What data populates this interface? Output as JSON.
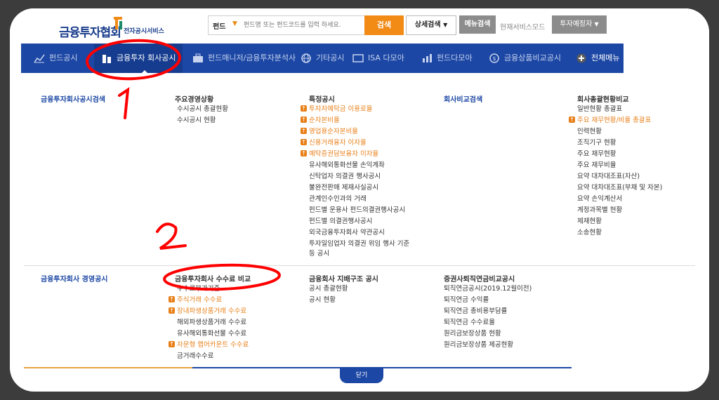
{
  "header": {
    "logo_main": "금융투자협회",
    "logo_sub": "전자공시서비스",
    "search_category": "펀드",
    "search_placeholder": "펀드명 또는 펀드코드를 입력 하세요.",
    "search_button": "검색",
    "detail_search_button": "상세검색",
    "menu_search_button": "메뉴검색",
    "service_mode_label": "현재서비스모드",
    "mode_select": "투자예정자"
  },
  "nav": {
    "items": [
      {
        "label": "펀드공시",
        "icon": "chart-icon"
      },
      {
        "label": "금융투자 회사공시",
        "icon": "building-icon"
      },
      {
        "label": "펀드매니저/금융투자분석사",
        "icon": "briefcase-icon"
      },
      {
        "label": "기타공시",
        "icon": "globe-icon"
      },
      {
        "label": "ISA 다모아",
        "icon": "isa-icon"
      },
      {
        "label": "펀드다모아",
        "icon": "bars-icon"
      },
      {
        "label": "금융상품비교공시",
        "icon": "coin-icon"
      },
      {
        "label": "전체메뉴",
        "icon": "plus-circle-icon"
      }
    ]
  },
  "menu": {
    "col1_top": "금융투자회사공시검색",
    "col2_top": "주요경영상황",
    "col2_top_items": [
      "수시공시 총괄현황",
      "수시공시 현황"
    ],
    "col3_top": "특정공시",
    "col3_top_items_orange": [
      "투자자예탁금 이용료율",
      "순자본비율",
      "영업용순자본비율",
      "신용거래융자 이자율",
      "예탁증권담보융자 이자율"
    ],
    "col3_top_items": [
      "유사해외통화선물 손익계좌",
      "신탁업자 의결권 행사공시",
      "불완전판매 제재사실공시",
      "관계인수인과의 거래",
      "펀드별 운용사 펀드의결권행사공시",
      "펀드별 의결권행사공시",
      "외국금융투자회사 약관공시",
      "투자일임업자 의결권 위임 행사 기준",
      "등 공시"
    ],
    "col4_top": "회사비교검색",
    "col5_top": "회사총괄현황비교",
    "col5_items": [
      {
        "label": "일반현황 총괄표",
        "orange": false
      },
      {
        "label": "주요 재무현황/비율 총괄표",
        "orange": true
      },
      {
        "label": "인력현황",
        "orange": false
      },
      {
        "label": "조직기구 현황",
        "orange": false
      },
      {
        "label": "주요 재무현황",
        "orange": false
      },
      {
        "label": "주요 재무비율",
        "orange": false
      },
      {
        "label": "요약 대차대조표(자산)",
        "orange": false
      },
      {
        "label": "요약 대차대조표(부채 및 자본)",
        "orange": false
      },
      {
        "label": "요약 손익계산서",
        "orange": false
      },
      {
        "label": "계정과목별 현황",
        "orange": false
      },
      {
        "label": "제재현황",
        "orange": false
      },
      {
        "label": "소송현황",
        "orange": false
      }
    ],
    "col1_bottom": "금융투자회사 경영공시",
    "col2_bottom": "금융투자회사 수수료 비교",
    "col2_bottom_items": [
      {
        "label": "수수료부과기준",
        "orange": false
      },
      {
        "label": "주식거래 수수료",
        "orange": true
      },
      {
        "label": "장내파생상품거래 수수료",
        "orange": true
      },
      {
        "label": "해외파생상품거래 수수료",
        "orange": false
      },
      {
        "label": "유사해외통화선물 수수료",
        "orange": false
      },
      {
        "label": "자문형 랩어카운트 수수료",
        "orange": true
      },
      {
        "label": "금거래수수료",
        "orange": false
      }
    ],
    "col3_bottom": "금융회사 지배구조 공시",
    "col3_bottom_items": [
      "공시 총괄현황",
      "공시 현황"
    ],
    "col4_bottom": "증권사퇴직연금비교공시",
    "col4_bottom_items": [
      "퇴직연금공시(2019.12월이전)",
      "퇴직연금 수익률",
      "퇴직연금 총비용부담률",
      "퇴직연금 수수료율",
      "원리금보장상품 현황",
      "원리금보장상품 제공현황"
    ],
    "close_button": "닫기"
  },
  "annotations": {
    "mark1": "1",
    "mark2": "2"
  },
  "colors": {
    "brand_blue": "#1c47a4",
    "orange": "#f28a16",
    "annotation_red": "#ff0000"
  }
}
